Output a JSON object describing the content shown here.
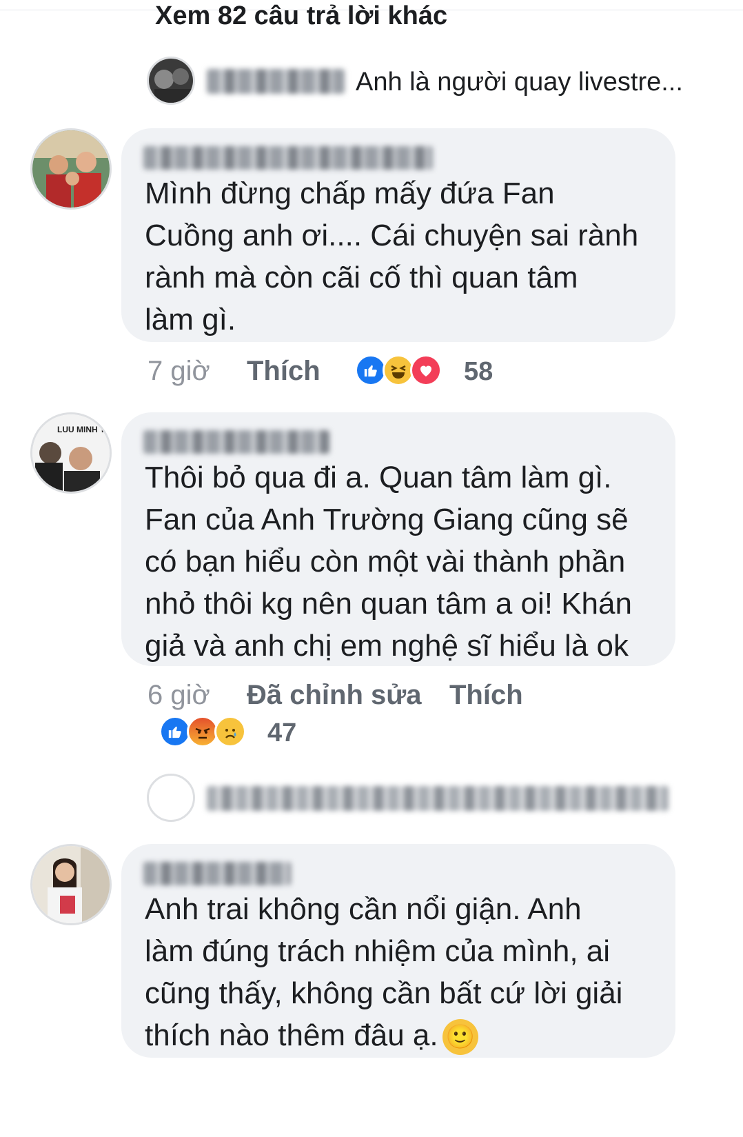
{
  "replies_link": {
    "label": "Xem 82 câu trả lời khác"
  },
  "reply_preview_1": {
    "text": "Anh là người quay livestre..."
  },
  "comments": [
    {
      "text": "Mình đừng chấp mấy đứa Fan\nCuồng anh ơi.... Cái chuyện sai rành\nrành mà còn cãi cố thì quan tâm\nlàm gì.",
      "time": "7 giờ",
      "like_label": "Thích",
      "reactions": [
        "like-icon",
        "haha-icon",
        "love-icon"
      ],
      "count": "58"
    },
    {
      "text": "Thôi bỏ qua đi a. Quan tâm làm gì.\nFan của Anh Trường Giang cũng sẽ\ncó bạn hiểu còn một vài thành phần\nnhỏ thôi kg nên quan tâm a oi! Khán\ngiả và anh chị em nghệ sĩ hiểu là ok",
      "time": "6 giờ",
      "edited_label": "Đã chỉnh sửa",
      "like_label": "Thích",
      "reactions": [
        "like-icon",
        "angry-icon",
        "sad-icon"
      ],
      "count": "47"
    },
    {
      "text": "Anh trai không cần nổi giận. Anh\nlàm đúng trách nhiệm của mình, ai\ncũng thấy, không cần bất cứ lời giải\nthích nào thêm đâu ạ.",
      "emoji": "🙂"
    }
  ],
  "colors": {
    "bubble": "#f0f2f5",
    "meta": "#90949c",
    "like": "#1877f2",
    "love": "#f33e58"
  }
}
